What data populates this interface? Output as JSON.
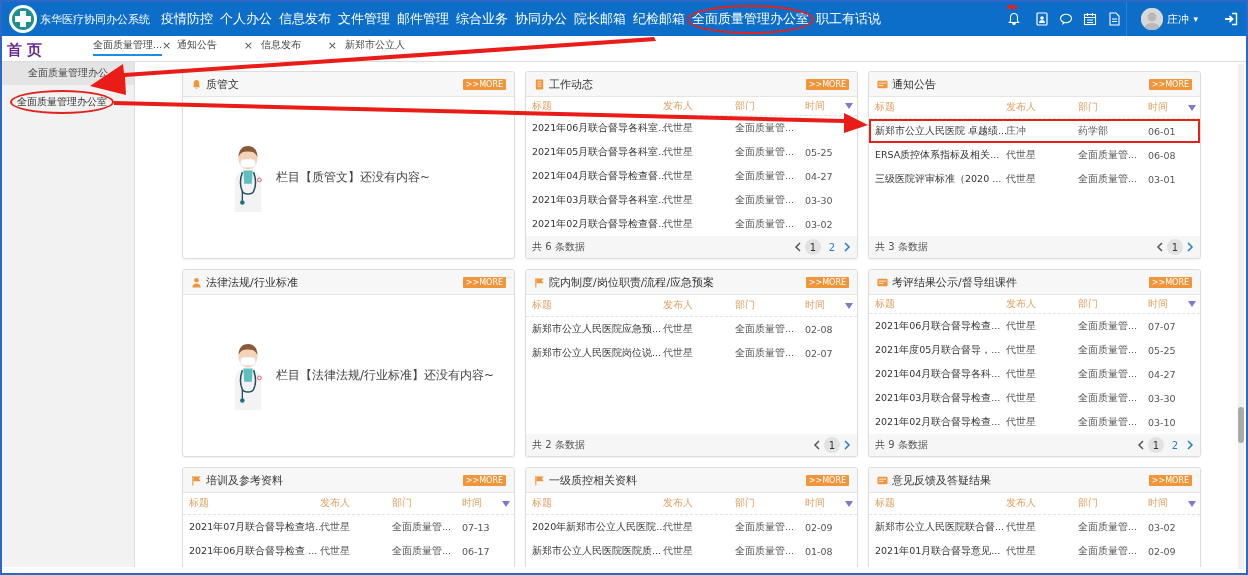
{
  "app_title": "东华医疗协同办公系统",
  "nav": [
    {
      "label": "疫情防控",
      "circled": false
    },
    {
      "label": "个人办公",
      "circled": false
    },
    {
      "label": "信息发布",
      "circled": false
    },
    {
      "label": "文件管理",
      "circled": false
    },
    {
      "label": "邮件管理",
      "circled": false
    },
    {
      "label": "综合业务",
      "circled": false
    },
    {
      "label": "协同办公",
      "circled": false
    },
    {
      "label": "院长邮箱",
      "circled": false
    },
    {
      "label": "纪检邮箱",
      "circled": false
    },
    {
      "label": "全面质量管理办公室",
      "circled": true
    },
    {
      "label": "职工有话说",
      "circled": false
    }
  ],
  "user": {
    "name": "庄冲",
    "caret": "▾"
  },
  "home_label": "首 页",
  "tabs": [
    {
      "label": "全面质量管理...",
      "close": "×",
      "selected": true
    },
    {
      "label": "通知公告",
      "close": "×",
      "selected": false
    },
    {
      "label": "信息发布",
      "close": "×",
      "selected": false
    },
    {
      "label": "新郑市公立人",
      "selected": false
    }
  ],
  "sidebar": {
    "header": "全面质量管理办公",
    "items": [
      {
        "label": "全面质量管理办公室",
        "circled": true
      }
    ]
  },
  "panels": [
    {
      "title": "质管文",
      "more": ">>MORE",
      "kind": "empty",
      "message": "栏目【质管文】还没有内容~"
    },
    {
      "title": "工作动态",
      "more": ">>MORE",
      "kind": "table",
      "columns": [
        "标题",
        "发布人",
        "部门",
        "时间"
      ],
      "rows": [
        {
          "cells": [
            "2021年06月联合督导各科室...",
            "代世星",
            "全面质量管..."
          ],
          "highlighted": false
        },
        {
          "cells": [
            "2021年05月联合督导各科室...",
            "代世星",
            "全面质量管...",
            "05-25"
          ],
          "highlighted": false
        },
        {
          "cells": [
            "2021年04月联合督导检查督...",
            "代世星",
            "全面质量管...",
            "04-27"
          ],
          "highlighted": false
        },
        {
          "cells": [
            "2021年03月联合督导各科室...",
            "代世星",
            "全面质量管...",
            "03-30"
          ],
          "highlighted": false
        },
        {
          "cells": [
            "2021年02月联合督导检查督...",
            "代世星",
            "全面质量管...",
            "03-02"
          ],
          "highlighted": false
        }
      ],
      "total": "共 6 条数据",
      "pages": [
        {
          "label": "1",
          "selected": true
        },
        {
          "label": "2",
          "selected": false
        }
      ]
    },
    {
      "title": "通知公告",
      "more": ">>MORE",
      "kind": "table",
      "columns": [
        "标题",
        "发布人",
        "部门",
        "时间"
      ],
      "rows": [
        {
          "cells": [
            "新郑市公立人民医院 卓越绩...",
            "庄冲",
            "药学部",
            "06-01"
          ],
          "highlighted": true
        },
        {
          "cells": [
            "ERSA质控体系指标及相关...",
            "代世星",
            "全面质量管...",
            "06-08"
          ],
          "highlighted": false
        },
        {
          "cells": [
            "三级医院评审标准（2020 ...",
            "代世星",
            "全面质量管...",
            "03-01"
          ],
          "highlighted": false
        }
      ],
      "total": "共 3 条数据",
      "pages": [
        {
          "label": "1",
          "selected": true
        }
      ]
    },
    {
      "title": "法律法规/行业标准",
      "more": ">>MORE",
      "kind": "empty",
      "message": "栏目【法律法规/行业标准】还没有内容~"
    },
    {
      "title": "院内制度/岗位职责/流程/应急预案",
      "more": ">>MORE",
      "kind": "table",
      "columns": [
        "标题",
        "发布人",
        "部门",
        "时间"
      ],
      "rows": [
        {
          "cells": [
            "新郑市公立人民医院应急预...",
            "代世星",
            "全面质量管...",
            "02-08"
          ],
          "highlighted": false
        },
        {
          "cells": [
            "新郑市公立人民医院岗位说...",
            "代世星",
            "全面质量管...",
            "02-07"
          ],
          "highlighted": false
        }
      ],
      "total": "共 2 条数据",
      "pages": [
        {
          "label": "1",
          "selected": true
        }
      ]
    },
    {
      "title": "考评结果公示/督导组课件",
      "more": ">>MORE",
      "kind": "table",
      "columns": [
        "标题",
        "发布人",
        "部门",
        "时间"
      ],
      "rows": [
        {
          "cells": [
            "2021年06月联合督导检查...",
            "代世星",
            "全面质量管...",
            "07-07"
          ],
          "highlighted": false
        },
        {
          "cells": [
            "2021年度05月联合督导，...",
            "代世星",
            "全面质量管...",
            "05-25"
          ],
          "highlighted": false
        },
        {
          "cells": [
            "2021年04月联合督导各科...",
            "代世星",
            "全面质量管...",
            "04-27"
          ],
          "highlighted": false
        },
        {
          "cells": [
            "2021年03月联合督导检查...",
            "代世星",
            "全面质量管...",
            "03-30"
          ],
          "highlighted": false
        },
        {
          "cells": [
            "2021年02月联合督导检查...",
            "代世星",
            "全面质量管...",
            "03-10"
          ],
          "highlighted": false
        }
      ],
      "total": "共 9 条数据",
      "pages": [
        {
          "label": "1",
          "selected": true
        },
        {
          "label": "2",
          "selected": false
        }
      ]
    },
    {
      "title": "培训及参考资料",
      "more": ">>MORE",
      "kind": "table",
      "columns": [
        "标题",
        "发布人",
        "部门",
        "时间"
      ],
      "rows": [
        {
          "cells": [
            "2021年07月联合督导检查培...",
            "代世星",
            "全面质量管...",
            "07-13"
          ],
          "highlighted": false
        },
        {
          "cells": [
            "2021年06月联合督导检查 ...",
            "代世星",
            "全面质量管...",
            "06-17"
          ],
          "highlighted": false
        }
      ]
    },
    {
      "title": "一级质控相关资料",
      "more": ">>MORE",
      "kind": "table",
      "columns": [
        "标题",
        "发布人",
        "部门",
        "时间"
      ],
      "rows": [
        {
          "cells": [
            "2020年新郑市公立人民医院...",
            "代世星",
            "全面质量管...",
            "02-09"
          ],
          "highlighted": false
        },
        {
          "cells": [
            "新郑市公立人民医院医院质...",
            "代世星",
            "全面质量管...",
            "01-08"
          ],
          "highlighted": false
        }
      ]
    },
    {
      "title": "意见反馈及答疑结果",
      "more": ">>MORE",
      "kind": "table",
      "columns": [
        "标题",
        "发布人",
        "部门",
        "时间"
      ],
      "rows": [
        {
          "cells": [
            "新郑市公立人民医院联合督...",
            "代世星",
            "全面质量管...",
            "03-02"
          ],
          "highlighted": false
        },
        {
          "cells": [
            "2021年01月联合督导意见...",
            "代世星",
            "全面质量管...",
            "02-09"
          ],
          "highlighted": false
        }
      ]
    }
  ]
}
